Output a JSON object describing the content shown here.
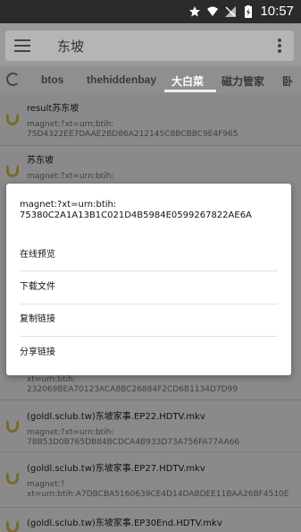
{
  "status_bar": {
    "time": "10:57"
  },
  "toolbar": {
    "search_query": "东坡"
  },
  "tabs": [
    {
      "label": "btos"
    },
    {
      "label": "thehiddenbay"
    },
    {
      "label": "大白菜"
    },
    {
      "label": "磁力管家"
    },
    {
      "label": "卧"
    }
  ],
  "list": {
    "rows": [
      {
        "title": "result苏东坡",
        "sub": "magnet:?xt=urn:btih:\n75D4322EE7DAAE2BD86A212145C8BCBBC9E4F965"
      },
      {
        "title": "苏东坡",
        "sub": "magnet:?xt=urn:btih:"
      },
      {
        "title": "",
        "sub": "xt=urn:btih:\n232069BEA70123ACA8BC26884F2CD6B1134D7D99"
      },
      {
        "title": "(goldl.sclub.tw)东坡家事.EP22.HDTV.mkv",
        "sub": "magnet:?xt=urn:btih:\n78B53D0B765DB84BCDCA4B933D73A756FA77AA66"
      },
      {
        "title": "(goldl.sclub.tw)东坡家事.EP27.HDTV.mkv",
        "sub": "magnet:?\nxt=urn:btih:A7DBCBA5160639CE4D14DABDEE11BAA26BF4510E"
      },
      {
        "title": "(goldl.sclub.tw)东坡家事.EP30End.HDTV.mkv",
        "sub": ""
      }
    ]
  },
  "dialog": {
    "title": "magnet:?xt=urn:btih:\n75380C2A1A13B1C021D4B5984E0599267822AE6A",
    "items": [
      "在线预览",
      "下载文件",
      "复制链接",
      "分享链接"
    ]
  }
}
